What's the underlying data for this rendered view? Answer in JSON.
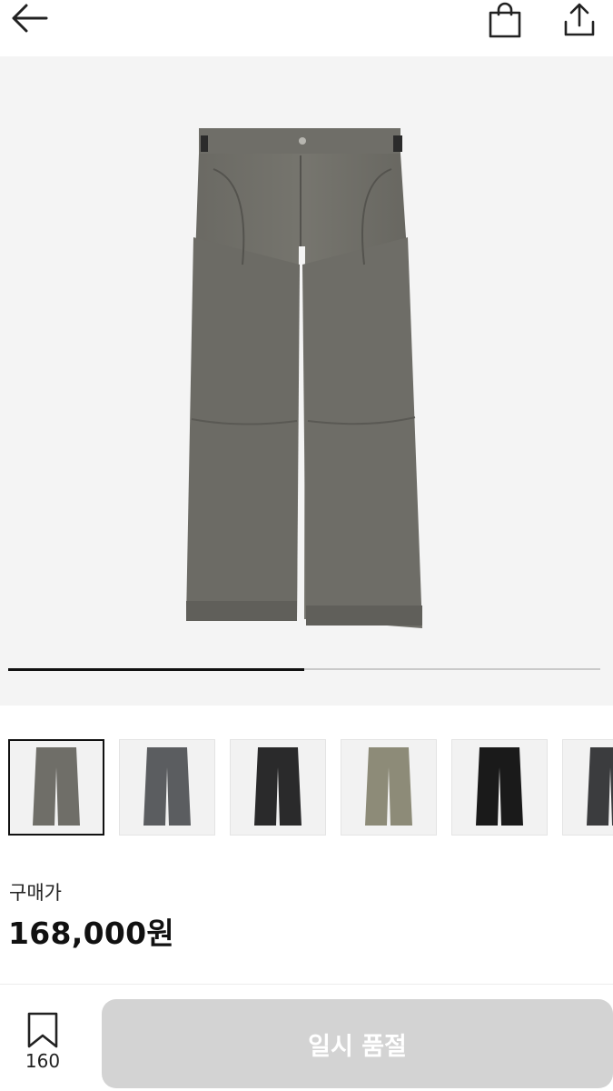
{
  "header": {
    "back_icon": "arrow-left-icon",
    "bag_icon": "shopping-bag-icon",
    "share_icon": "share-upload-icon"
  },
  "hero": {
    "image": "gray-wide-pants-image",
    "carousel_progress": 0.5
  },
  "thumbnails": [
    {
      "name": "thumbnail-gray-front",
      "color": "#6f6e68",
      "selected": true
    },
    {
      "name": "thumbnail-charcoal-front",
      "color": "#5b5d60",
      "selected": false
    },
    {
      "name": "thumbnail-black-washed",
      "color": "#2a2a2b",
      "selected": false
    },
    {
      "name": "thumbnail-olive-front",
      "color": "#8d8b78",
      "selected": false
    },
    {
      "name": "thumbnail-black-solid",
      "color": "#1a1a1a",
      "selected": false
    },
    {
      "name": "thumbnail-dark-gray-partial",
      "color": "#3b3c3e",
      "selected": false
    }
  ],
  "price": {
    "label": "구매가",
    "value": "168,000원"
  },
  "footer": {
    "bookmark_icon": "bookmark-icon",
    "bookmark_count": "160",
    "button_label": "일시 품절"
  },
  "colors": {
    "hero_bg": "#f4f4f4",
    "button_disabled": "#d3d3d3",
    "progress_active": "#111111",
    "progress_track": "#c9c9c9"
  }
}
